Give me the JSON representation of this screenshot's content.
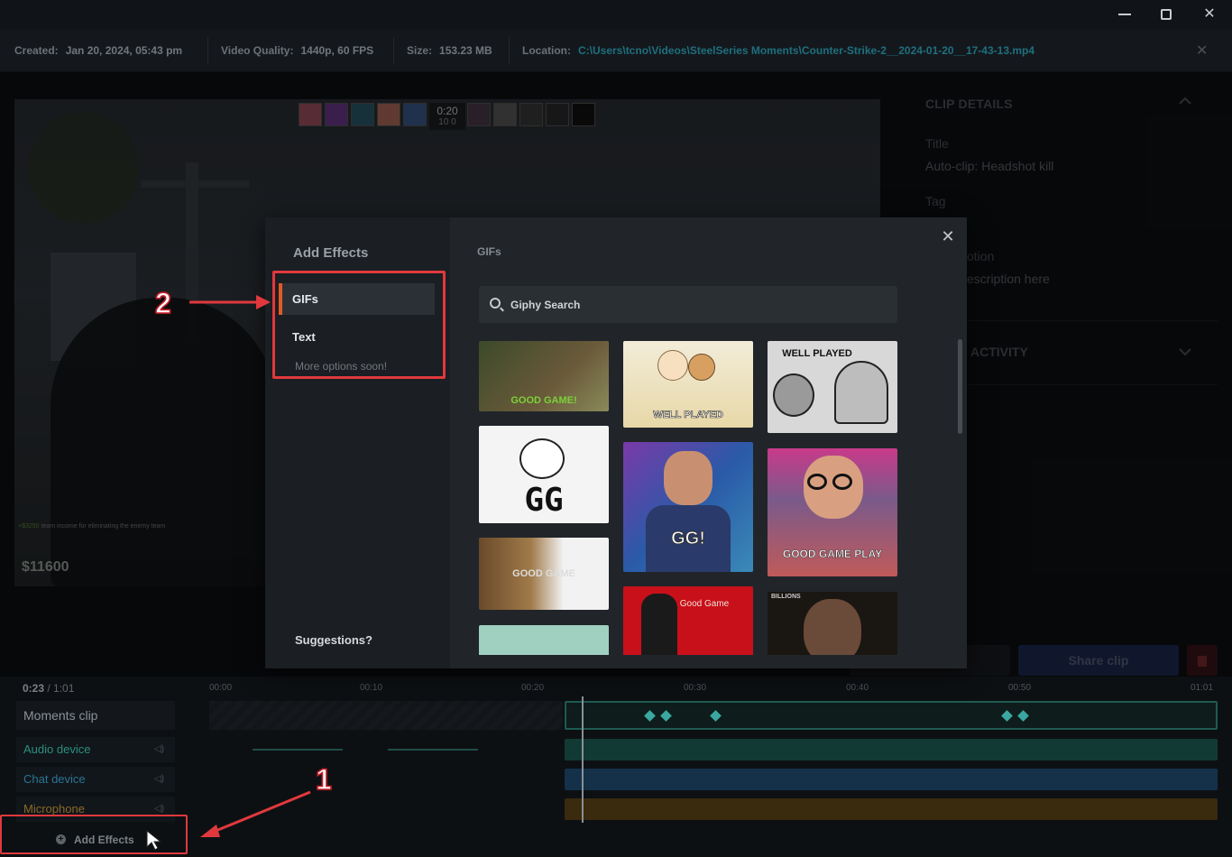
{
  "window": {
    "minimize": "—",
    "maximize": "☐",
    "close": "✕"
  },
  "info": {
    "created_label": "Created:",
    "created_value": "Jan 20, 2024, 05:43 pm",
    "quality_label": "Video Quality:",
    "quality_value": "1440p, 60 FPS",
    "size_label": "Size:",
    "size_value": "153.23 MB",
    "location_label": "Location:",
    "location_value": "C:\\Users\\tcno\\Videos\\SteelSeries Moments\\Counter-Strike-2__2024-01-20__17-43-13.mp4",
    "close": "✕"
  },
  "video": {
    "timer": "0:20",
    "score_left": "10",
    "score_right": "0",
    "money": "$11600",
    "money_note_amount": "+$3250",
    "money_note_text": "team income for eliminating the enemy team"
  },
  "details": {
    "title": "CLIP DETAILS",
    "title_label": "Title",
    "title_value": "Auto-clip: Headshot kill",
    "tag_label": "Tag",
    "desc_label": "otion",
    "desc_value": "escription here",
    "activity": "ACTIVITY"
  },
  "actions": {
    "share": "Share clip"
  },
  "timeline": {
    "current": "0:23",
    "total": "/ 1:01",
    "ticks": [
      "00:00",
      "00:10",
      "00:20",
      "00:30",
      "00:40",
      "00:50",
      "01:01"
    ],
    "tracks": [
      {
        "label": "Moments clip",
        "color": "#8c9197"
      },
      {
        "label": "Audio device",
        "color": "#2c8f80"
      },
      {
        "label": "Chat device",
        "color": "#2c7396"
      },
      {
        "label": "Microphone",
        "color": "#8a6a2a"
      }
    ],
    "add_effects": "Add Effects"
  },
  "modal": {
    "side_title": "Add Effects",
    "menu": [
      {
        "label": "GIFs",
        "active": true
      },
      {
        "label": "Text",
        "active": false
      }
    ],
    "more_options": "More options soon!",
    "suggestions": "Suggestions?",
    "main_title": "GIFs",
    "search_placeholder": "Giphy Search",
    "close": "✕",
    "gifs": [
      {
        "caption": "GOOD GAME!"
      },
      {
        "caption": "WELL PLAYED"
      },
      {
        "caption": "WELL PLAYED"
      },
      {
        "caption": "GG"
      },
      {
        "caption": "GG!"
      },
      {
        "caption": "GOOD GAME PLAY"
      },
      {
        "caption": "GOOD GAME"
      },
      {
        "caption": "Good Game"
      },
      {
        "caption": "BILLIONS"
      },
      {
        "caption": ""
      }
    ]
  },
  "callouts": {
    "step1": "1",
    "step2": "2"
  },
  "colors": {
    "accent": "#e05a25",
    "callout_red": "#e0393d",
    "link": "#1e6f7f"
  }
}
